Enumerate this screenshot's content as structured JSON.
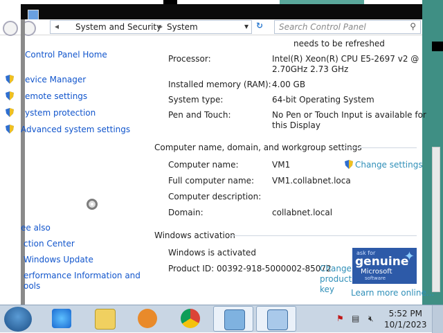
{
  "window": {
    "title": ""
  },
  "address": {
    "crumbs": [
      "System and Security",
      "System"
    ],
    "search_placeholder": "Search Control Panel"
  },
  "notice": "needs to be refreshed",
  "sidebar": {
    "home": "Control Panel Home",
    "tasks": [
      {
        "label": "evice Manager",
        "icon": "shield-icon"
      },
      {
        "label": "emote settings",
        "icon": "shield-icon"
      },
      {
        "label": "ystem protection",
        "icon": "shield-icon"
      },
      {
        "label": "Advanced system settings",
        "icon": "shield-icon"
      }
    ],
    "see_also": "ee also",
    "links": [
      "ction Center",
      "Windows Update",
      "erformance Information and",
      "ools"
    ]
  },
  "system": {
    "processor_label": "Processor:",
    "processor_value": [
      "Intel(R) Xeon(R) CPU E5-2697 v2 @",
      "2.70GHz   2.73 GHz"
    ],
    "ram_label": "Installed memory (RAM):",
    "ram_value": "4.00 GB",
    "type_label": "System type:",
    "type_value": "64-bit Operating System",
    "pen_label": "Pen and Touch:",
    "pen_value": [
      "No Pen or Touch Input is available for",
      "this Display"
    ]
  },
  "computer": {
    "section": "Computer name, domain, and workgroup settings",
    "name_label": "Computer name:",
    "name_value": "VM1",
    "full_label": "Full computer name:",
    "full_value": "VM1.collabnet.loca",
    "desc_label": "Computer description:",
    "desc_value": "",
    "domain_label": "Domain:",
    "domain_value": "collabnet.local",
    "change_settings": "Change settings"
  },
  "activation": {
    "section": "Windows activation",
    "status": "Windows is activated",
    "product_id": "Product ID:  00392-918-5000002-85072",
    "change_key": [
      "Change",
      "product",
      "key"
    ],
    "genuine": {
      "askfor": "ask for",
      "title": "genuine",
      "brand": "Microsoft",
      "sub": "software"
    },
    "learn_more": "Learn more online..."
  },
  "taskbar": {
    "apps": [
      "internet-explorer-icon",
      "file-explorer-icon",
      "media-player-icon",
      "chrome-icon",
      "control-panel-icon",
      "network-icon"
    ],
    "time": "5:52 PM",
    "date": "10/1/2023"
  },
  "colors": {
    "link": "#1155cc",
    "accent": "#2f8fb8",
    "taskbar": "#c9d6e4",
    "titlebar": "#0b0b0b"
  }
}
